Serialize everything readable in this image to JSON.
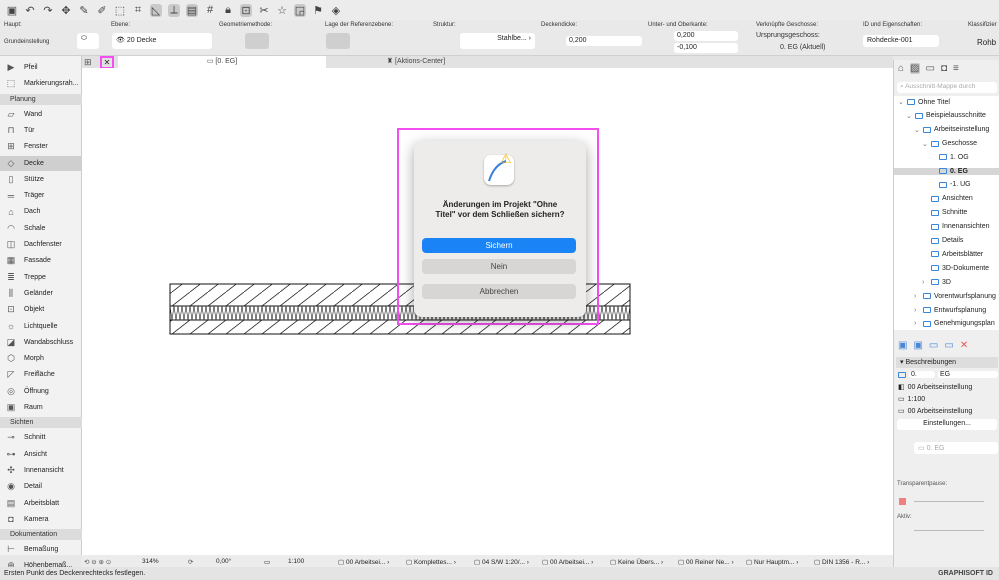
{
  "toolbar": {
    "icons": [
      "save-icon",
      "undo-icon",
      "redo-icon",
      "pick-up-icon",
      "eyedropper-icon",
      "inject-icon",
      "magic-wand-icon",
      "snap-icon",
      "angle-guide-icon",
      "guide-line-icon",
      "grid-snap-icon",
      "grid-icon",
      "lock-icon",
      "suspend-groups-icon",
      "trim-icon",
      "favorites-icon",
      "layer-icon",
      "flag-icon",
      "3d-icon"
    ]
  },
  "info": {
    "haupt": "Haupt:",
    "grundeinstellung": "Grundeinstellung",
    "ebene_label": "Ebene:",
    "ebene": "20 Decke",
    "geometrie_label": "Geometriemethode:",
    "referenz_label": "Lage der Referenzebene:",
    "struktur_label": "Struktur:",
    "struktur": "Stahlbe...",
    "dicke_label": "Deckendicke:",
    "dicke": "0,200",
    "kante_label": "Unter- und Oberkante:",
    "oberkante": "0,200",
    "unterkante": "-0,100",
    "geschosse_label": "Verknüpfte Geschosse:",
    "ursprung_label": "Ursprungsgeschoss:",
    "ursprung": "0. EG (Aktuell)",
    "id_label": "ID und Eigenschaften:",
    "id": "Rohdecke-001",
    "klass_label": "Klassifizier",
    "klass": "Rohb"
  },
  "tabs": [
    {
      "label": "[0. EG]"
    },
    {
      "label": "[Aktions-Center]"
    }
  ],
  "sidebar": {
    "items": [
      {
        "type": "item",
        "label": "Pfeil",
        "icon": "▶"
      },
      {
        "type": "item",
        "label": "Markierungsrah...",
        "icon": "⬚"
      },
      {
        "type": "header",
        "label": "Planung"
      },
      {
        "type": "item",
        "label": "Wand",
        "icon": "▱"
      },
      {
        "type": "item",
        "label": "Tür",
        "icon": "⊓"
      },
      {
        "type": "item",
        "label": "Fenster",
        "icon": "⊞"
      },
      {
        "type": "item",
        "label": "Decke",
        "icon": "◇",
        "selected": true
      },
      {
        "type": "item",
        "label": "Stütze",
        "icon": "▯"
      },
      {
        "type": "item",
        "label": "Träger",
        "icon": "═"
      },
      {
        "type": "item",
        "label": "Dach",
        "icon": "⌂"
      },
      {
        "type": "item",
        "label": "Schale",
        "icon": "◠"
      },
      {
        "type": "item",
        "label": "Dachfenster",
        "icon": "◫"
      },
      {
        "type": "item",
        "label": "Fassade",
        "icon": "▦"
      },
      {
        "type": "item",
        "label": "Treppe",
        "icon": "≣"
      },
      {
        "type": "item",
        "label": "Geländer",
        "icon": "⫼"
      },
      {
        "type": "item",
        "label": "Objekt",
        "icon": "⊡"
      },
      {
        "type": "item",
        "label": "Lichtquelle",
        "icon": "☼"
      },
      {
        "type": "item",
        "label": "Wandabschluss",
        "icon": "◪"
      },
      {
        "type": "item",
        "label": "Morph",
        "icon": "⬡"
      },
      {
        "type": "item",
        "label": "Freifläche",
        "icon": "◸"
      },
      {
        "type": "item",
        "label": "Öffnung",
        "icon": "◎"
      },
      {
        "type": "item",
        "label": "Raum",
        "icon": "▣"
      },
      {
        "type": "header",
        "label": "Sichten"
      },
      {
        "type": "item",
        "label": "Schnitt",
        "icon": "⊸"
      },
      {
        "type": "item",
        "label": "Ansicht",
        "icon": "⊶"
      },
      {
        "type": "item",
        "label": "Innenansicht",
        "icon": "✣"
      },
      {
        "type": "item",
        "label": "Detail",
        "icon": "◉"
      },
      {
        "type": "item",
        "label": "Arbeitsblatt",
        "icon": "▤"
      },
      {
        "type": "item",
        "label": "Kamera",
        "icon": "◘"
      },
      {
        "type": "header",
        "label": "Dokumentation"
      },
      {
        "type": "item",
        "label": "Bemaßung",
        "icon": "⊢"
      },
      {
        "type": "item",
        "label": "Höhenbemaß...",
        "icon": "⊕"
      }
    ]
  },
  "dialog": {
    "message": "Änderungen im Projekt \"Ohne Titel\" vor dem Schließen sichern?",
    "save": "Sichern",
    "no": "Nein",
    "cancel": "Abbrechen"
  },
  "navigator": {
    "search_placeholder": "Ausschnitt-Mappe durch",
    "tree": [
      {
        "label": "Ohne Titel",
        "level": 0,
        "arrow": "⌄"
      },
      {
        "label": "Beispielausschnitte",
        "level": 1,
        "arrow": "⌄"
      },
      {
        "label": "Arbeitseinstellung",
        "level": 2,
        "arrow": "⌄"
      },
      {
        "label": "Geschosse",
        "level": 3,
        "arrow": "⌄"
      },
      {
        "label": "1. OG",
        "level": 4
      },
      {
        "label": "0. EG",
        "level": 4,
        "selected": true
      },
      {
        "label": "-1. UG",
        "level": 4
      },
      {
        "label": "Ansichten",
        "level": 3
      },
      {
        "label": "Schnitte",
        "level": 3
      },
      {
        "label": "Innenansichten",
        "level": 3
      },
      {
        "label": "Details",
        "level": 3
      },
      {
        "label": "Arbeitsblätter",
        "level": 3
      },
      {
        "label": "3D-Dokumente",
        "level": 3
      },
      {
        "label": "3D",
        "level": 3,
        "arrow": "›"
      },
      {
        "label": "Vorentwurfsplanung",
        "level": 2,
        "arrow": "›"
      },
      {
        "label": "Entwurfsplanung",
        "level": 2,
        "arrow": "›"
      },
      {
        "label": "Genehmigungsplan",
        "level": 2,
        "arrow": "›"
      }
    ]
  },
  "desc": {
    "header": "Beschreibungen",
    "num": "0.",
    "name": "EG",
    "layer": "00 Arbeitseinstellung",
    "scale": "1:100",
    "model": "00 Arbeitseinstellung",
    "settings": "Einstellungen...",
    "view": "0. EG",
    "transparent": "Transparentpause:",
    "active": "Aktiv:"
  },
  "bottom": {
    "zoom": "314%",
    "angle": "0,00°",
    "scale": "1:100",
    "items": [
      "00 Arbeitsei...",
      "Komplettes...",
      "04 S/W 1:20/...",
      "00 Arbeitsei...",
      "Keine Übers...",
      "00 Reiner Ne...",
      "Nur Hauptm...",
      "DIN 1356 - R..."
    ]
  },
  "status": {
    "text": "Ersten Punkt des Deckenrechtecks festlegen.",
    "brand": "GRAPHISOFT ID"
  }
}
